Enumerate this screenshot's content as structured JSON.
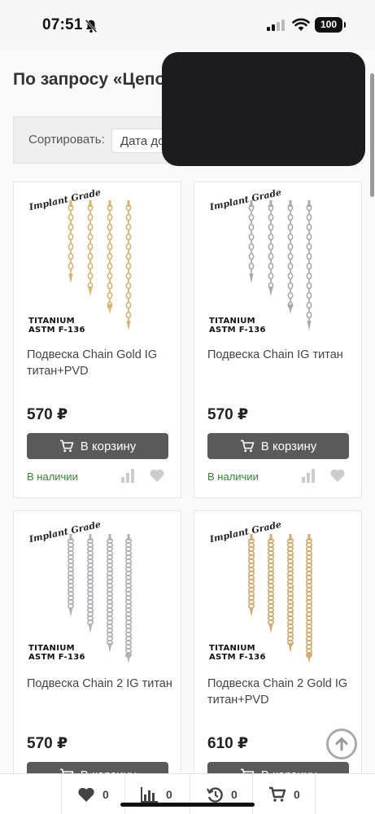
{
  "status_bar": {
    "time": "07:51",
    "battery": "100"
  },
  "page": {
    "title": "По запросу «Цепочка»"
  },
  "sort": {
    "label": "Сортировать:",
    "value": "Дата добавления"
  },
  "products": [
    {
      "title": "Подвеска Chain Gold IG титан+PVD",
      "price": "570 ₽",
      "button": "В корзину",
      "stock": "В наличии",
      "brand": "Implant Grade",
      "material": [
        "TITANIUM",
        "ASTM F-136"
      ],
      "chain_color": "#d9b46a"
    },
    {
      "title": "Подвеска Chain IG титан",
      "price": "570 ₽",
      "button": "В корзину",
      "stock": "В наличии",
      "brand": "Implant Grade",
      "material": [
        "TITANIUM",
        "ASTM F-136"
      ],
      "chain_color": "#a9a9ad"
    },
    {
      "title": "Подвеска Chain 2 IG титан",
      "price": "570 ₽",
      "button": "В корзину",
      "stock": "",
      "brand": "Implant Grade",
      "material": [
        "TITANIUM",
        "ASTM F-136"
      ],
      "chain_color": "#b2b2b6"
    },
    {
      "title": "Подвеска Chain 2 Gold IG титан+PVD",
      "price": "610 ₽",
      "button": "В корзину",
      "stock": "",
      "brand": "Implant Grade",
      "material": [
        "TITANIUM",
        "ASTM F-136"
      ],
      "chain_color": "#d8aa6a"
    }
  ],
  "bottom_bar": {
    "favorites_count": "0",
    "compare_count": "0",
    "history_count": "0",
    "cart_count": "0"
  },
  "icons": {
    "bell": "bell-slash-icon",
    "signal": "signal-icon",
    "wifi": "wifi-icon",
    "cart": "cart-icon",
    "compare": "bar-chart-icon",
    "favorite": "heart-icon",
    "history": "history-icon",
    "to_top": "arrow-up-icon"
  },
  "colors": {
    "button": "#5a5a5a",
    "in_stock": "#2c8a2c",
    "overlay": "#1c1c1e"
  }
}
